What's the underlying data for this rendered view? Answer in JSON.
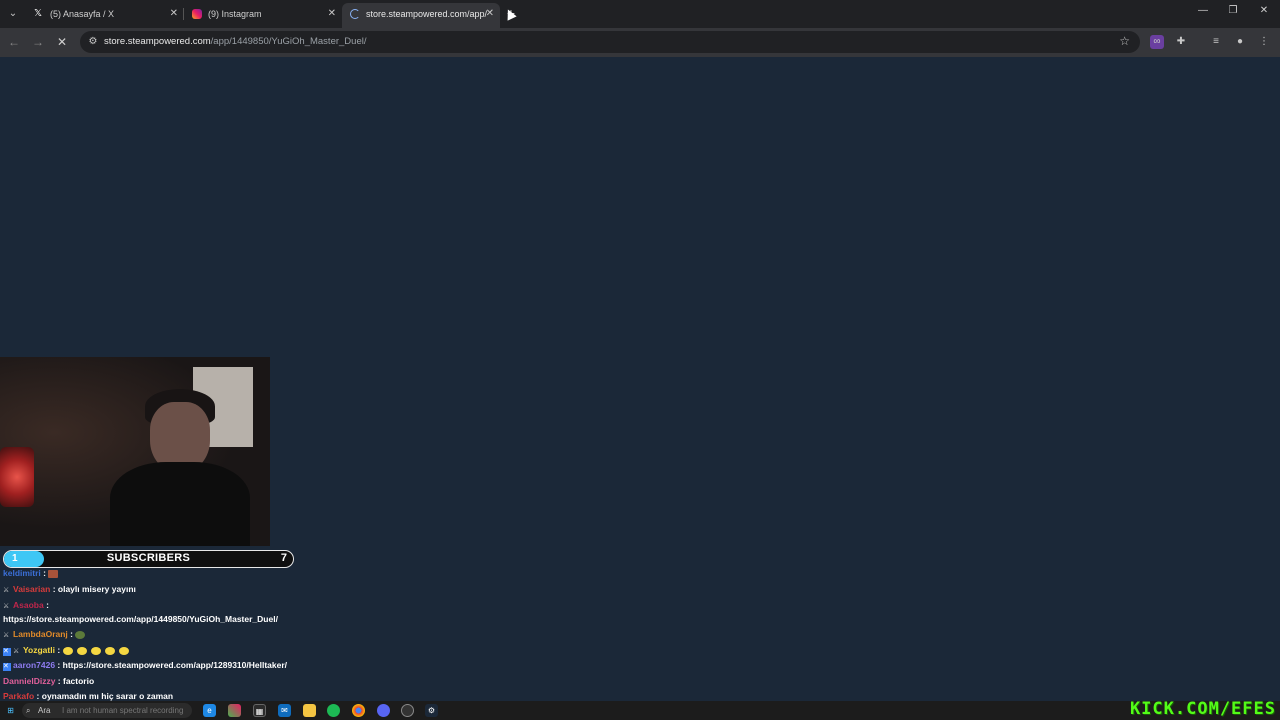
{
  "browser": {
    "tabs": [
      {
        "title": "(5) Anasayfa / X",
        "icon": "x-logo-icon",
        "active": false
      },
      {
        "title": "(9) Instagram",
        "icon": "instagram-icon",
        "active": false
      },
      {
        "title": "store.steampowered.com/app/",
        "icon": "loading-icon",
        "active": true
      }
    ],
    "new_tab": "+",
    "window_controls": {
      "minimize": "—",
      "maximize": "❐",
      "close": "✕"
    },
    "address": {
      "host": "store.steampowered.com",
      "path": "/app/1449850/YuGiOh_Master_Duel/"
    },
    "nav": {
      "back": "←",
      "forward": "→",
      "stop": "✕"
    }
  },
  "stream_overlay": {
    "subscribers": {
      "label": "SUBSCRIBERS",
      "current": "1",
      "goal": "7",
      "progress_fraction": 0.14,
      "fill_color": "#3ec7f5"
    },
    "chat": [
      {
        "user": "keldimitri",
        "user_color": "#3b6fd6",
        "text": "",
        "emotes": [
          "alt"
        ],
        "badges": []
      },
      {
        "user": "Vaisarian",
        "user_color": "#d63b3b",
        "text": "olaylı misery yayını",
        "emotes": [],
        "badges": [
          "sword"
        ]
      },
      {
        "user": "Asaoba",
        "user_color": "#c0264b",
        "text": "",
        "emotes": [],
        "badges": [
          "sword"
        ]
      },
      {
        "user": "",
        "user_color": "#ffffff",
        "text": "https://store.steampowered.com/app/1449850/YuGiOh_Master_Duel/",
        "emotes": [],
        "badges": []
      },
      {
        "user": "LambdaOranj",
        "user_color": "#e08a2a",
        "text": "",
        "emotes": [
          "frog"
        ],
        "badges": [
          "sword"
        ]
      },
      {
        "user": "Yozgatli",
        "user_color": "#f5d742",
        "text": "",
        "emotes": [
          "yellow",
          "yellow",
          "yellow",
          "yellow",
          "yellow"
        ],
        "badges": [
          "boost",
          "sword"
        ]
      },
      {
        "user": "aaron7426",
        "user_color": "#8e7cf0",
        "text": "https://store.steampowered.com/app/1289310/Helltaker/",
        "emotes": [],
        "badges": [
          "boost"
        ]
      },
      {
        "user": "DannielDizzy",
        "user_color": "#e0609a",
        "text": "factorio",
        "emotes": [],
        "badges": []
      },
      {
        "user": "Parkafo",
        "user_color": "#d63b3b",
        "text": "oynamadın mı hiç sarar o zaman",
        "emotes": [],
        "badges": []
      }
    ],
    "watermark": "KICK.COM/EFES"
  },
  "taskbar": {
    "search_placeholder": "Ara",
    "search_overlay_text": "I am not human spectral recording",
    "apps": [
      "start-icon",
      "edge-icon",
      "copilot-icon",
      "store-icon",
      "outlook-icon",
      "explorer-icon",
      "spotify-icon",
      "chrome-icon",
      "discord-icon",
      "obs-icon",
      "steam-icon"
    ]
  }
}
